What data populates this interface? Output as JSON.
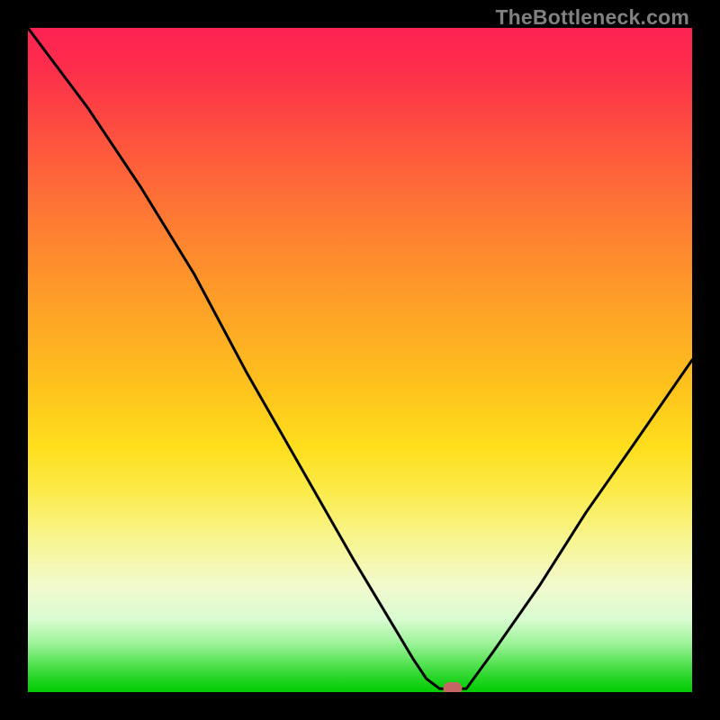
{
  "watermark": "TheBottleneck.com",
  "colors": {
    "frame": "#000000",
    "curve": "#000000",
    "marker": "#c76464",
    "gradient_top": "#fd2253",
    "gradient_mid": "#fede1c",
    "gradient_bottom": "#00cc00"
  },
  "chart_data": {
    "type": "line",
    "title": "",
    "xlabel": "",
    "ylabel": "",
    "xlim": [
      0,
      100
    ],
    "ylim": [
      0,
      100
    ],
    "series": [
      {
        "name": "bottleneck-curve",
        "x": [
          0,
          9,
          17,
          25,
          33,
          41,
          49,
          55,
          58,
          60,
          62,
          64,
          66,
          70,
          77,
          84,
          91,
          100
        ],
        "values": [
          100,
          88,
          76,
          63,
          48,
          34,
          20,
          10,
          5,
          2,
          0.5,
          0.5,
          0.5,
          6,
          16,
          27,
          37,
          50
        ]
      }
    ],
    "marker": {
      "x": 64,
      "y": 0.5,
      "label": "optimal-point"
    },
    "grid": false,
    "legend_position": "none",
    "annotations": []
  }
}
